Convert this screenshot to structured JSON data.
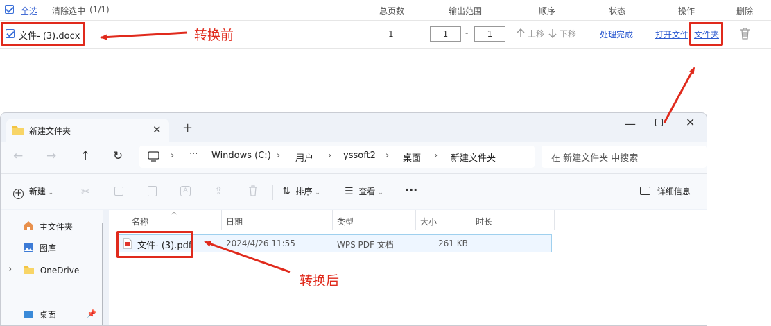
{
  "converter": {
    "select_all": "全选",
    "clear_selection": "清除选中",
    "selection_count": "(1/1)",
    "columns": [
      "总页数",
      "输出范围",
      "顺序",
      "状态",
      "操作",
      "删除"
    ],
    "row": {
      "filename": "文件- (3).docx",
      "total_pages": "1",
      "range_from": "1",
      "range_sep": "-",
      "range_to": "1",
      "move_up": "上移",
      "move_down": "下移",
      "status": "处理完成",
      "open_file": "打开文件",
      "folder": "文件夹"
    }
  },
  "annotations": {
    "before": "转换前",
    "after": "转换后"
  },
  "explorer": {
    "tab_title": "新建文件夹",
    "breadcrumb": [
      "Windows (C:)",
      "用户",
      "yssoft2",
      "桌面",
      "新建文件夹"
    ],
    "search_placeholder": "在 新建文件夹 中搜索",
    "cmd_new": "新建",
    "cmd_sort": "排序",
    "cmd_view": "查看",
    "cmd_more": "···",
    "cmd_details": "详细信息",
    "nav": [
      "主文件夹",
      "图库",
      "OneDrive",
      "桌面"
    ],
    "columns": [
      "名称",
      "日期",
      "类型",
      "大小",
      "时长"
    ],
    "file": {
      "name": "文件- (3).pdf",
      "date": "2024/4/26 11:55",
      "type": "WPS PDF 文档",
      "size": "261 KB"
    }
  },
  "colors": {
    "accent": "#2d5bd0",
    "annotation": "#e02a1c"
  }
}
